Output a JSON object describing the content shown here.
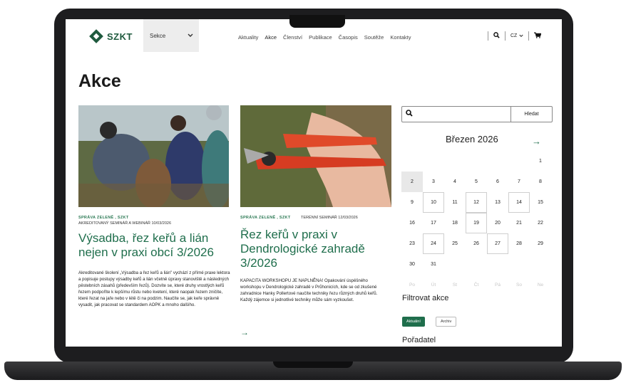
{
  "header": {
    "logo_text": "SZKT",
    "sekce_label": "Sekce",
    "nav": [
      "Aktuality",
      "Akce",
      "Členství",
      "Publikace",
      "Časopis",
      "Soutěže",
      "Kontakty"
    ],
    "lang": "CZ"
  },
  "page": {
    "title": "Akce"
  },
  "articles": [
    {
      "tags": "SPRÁVA ZELENĚ  , SZKT",
      "sub": "AKREDITOVANÝ SEMINÁŘ A WEBINÁŘ   10/03/2026",
      "title": "Výsadba, řez keřů a lián nejen v praxi obcí 3/2026",
      "text": "Akreditované školení „Výsadba a řez keřů a lián\" vychází z přímé praxe lektora a popisuje postupy výsadby keřů a lián včetně úpravy stanoviště a následných pěstebních zásahů (především řezů). Dozvíte se, které druhy vrostlých keřů řezem podpoříte k lepšímu růstu nebo kvetení, které naopak řezem zničíte, které řezat na jaře nebo v létě či na podzim. Naučíte se, jak keře správně vysadit, jak pracovat se standardem AOPK a mnoho dalšího."
    },
    {
      "tags": "SPRÁVA ZELENĚ  , SZKT",
      "sub": "TERÉNNÍ SEMINÁŘ   12/03/2026",
      "title": "Řez keřů v praxi v Dendrologické zahradě 3/2026",
      "text": "KAPACITA WORKSHOPU JE NAPLNĚNA! Opakování úspěšného workshopu v Dendrologické zahradě v Průhonicích, kde se od zkušené zahradnice Hanky Pollertové naučíte techniky řezu různých druhů keřů. Každý zájemce si jednotlivé techniky může sám vyzkoušet."
    }
  ],
  "sidebar": {
    "search_button": "Hledat",
    "calendar_title": "Březen 2026",
    "days": [
      "",
      "",
      "",
      "",
      "",
      "",
      "1",
      "2",
      "3",
      "4",
      "5",
      "6",
      "7",
      "8",
      "9",
      "10",
      "11",
      "12",
      "13",
      "14",
      "15",
      "16",
      "17",
      "18",
      "19",
      "20",
      "21",
      "22",
      "23",
      "24",
      "25",
      "26",
      "27",
      "28",
      "29",
      "30",
      "31",
      "",
      "",
      "",
      "",
      ""
    ],
    "event_days": [
      "10",
      "12",
      "14",
      "19",
      "24",
      "27"
    ],
    "today": "2",
    "weekdays": [
      "Po",
      "Út",
      "St",
      "Čt",
      "Pá",
      "So",
      "Ne"
    ],
    "filter_title": "Filtrovat akce",
    "filter_on": "Aktuální",
    "filter_off": "Archiv",
    "org_title": "Pořadatel"
  },
  "colors": {
    "brand": "#1f6e4c"
  }
}
